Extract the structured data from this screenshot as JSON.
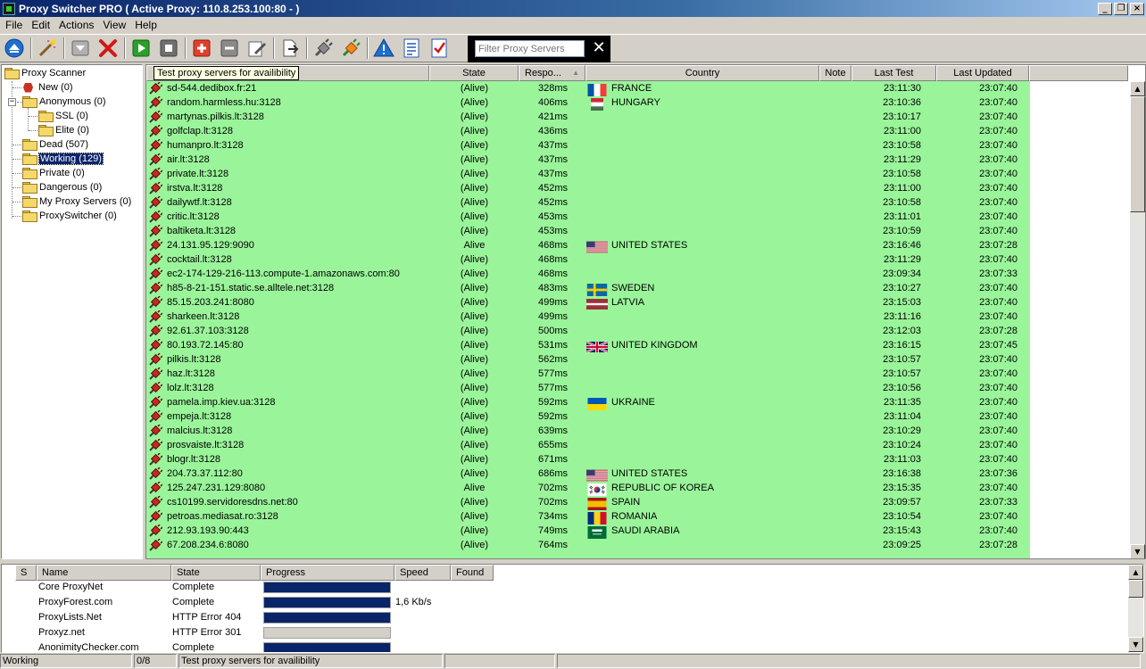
{
  "window": {
    "title": "Proxy Switcher PRO ( Active Proxy: 110.8.253.100:80 - )",
    "minimize": "_",
    "restore": "❐",
    "close": "×"
  },
  "menu": [
    "File",
    "Edit",
    "Actions",
    "View",
    "Help"
  ],
  "filter": {
    "placeholder": "Filter Proxy Servers",
    "clear": "✕"
  },
  "tree": {
    "items": [
      {
        "label": "Proxy Scanner"
      },
      {
        "label": "New (0)"
      },
      {
        "label": "Anonymous (0)"
      },
      {
        "label": "SSL (0)"
      },
      {
        "label": "Elite (0)"
      },
      {
        "label": "Dead (507)"
      },
      {
        "label": "Working (129)"
      },
      {
        "label": "Private (0)"
      },
      {
        "label": "Dangerous (0)"
      },
      {
        "label": "My Proxy Servers (0)"
      },
      {
        "label": "ProxySwitcher (0)"
      }
    ]
  },
  "grid": {
    "tooltip": "Test proxy servers for availibility",
    "columns": [
      "State",
      "Respo...",
      "Country",
      "Note",
      "Last Test",
      "Last Updated"
    ],
    "sort_indicator": "▲",
    "rows": [
      {
        "server": "sd-544.dedibox.fr:21",
        "state": "(Alive)",
        "resp": "328ms",
        "flag": "fr",
        "country": "FRANCE",
        "last_test": "23:11:30",
        "updated": "23:07:40"
      },
      {
        "server": "random.harmless.hu:3128",
        "state": "(Alive)",
        "resp": "406ms",
        "flag": "hu",
        "country": "HUNGARY",
        "last_test": "23:10:36",
        "updated": "23:07:40"
      },
      {
        "server": "martynas.pilkis.lt:3128",
        "state": "(Alive)",
        "resp": "421ms",
        "flag": "",
        "country": "",
        "last_test": "23:10:17",
        "updated": "23:07:40"
      },
      {
        "server": "golfclap.lt:3128",
        "state": "(Alive)",
        "resp": "436ms",
        "flag": "",
        "country": "",
        "last_test": "23:11:00",
        "updated": "23:07:40"
      },
      {
        "server": "humanpro.lt:3128",
        "state": "(Alive)",
        "resp": "437ms",
        "flag": "",
        "country": "",
        "last_test": "23:10:58",
        "updated": "23:07:40"
      },
      {
        "server": "air.lt:3128",
        "state": "(Alive)",
        "resp": "437ms",
        "flag": "",
        "country": "",
        "last_test": "23:11:29",
        "updated": "23:07:40"
      },
      {
        "server": "private.lt:3128",
        "state": "(Alive)",
        "resp": "437ms",
        "flag": "",
        "country": "",
        "last_test": "23:10:58",
        "updated": "23:07:40"
      },
      {
        "server": "irstva.lt:3128",
        "state": "(Alive)",
        "resp": "452ms",
        "flag": "",
        "country": "",
        "last_test": "23:11:00",
        "updated": "23:07:40"
      },
      {
        "server": "dailywtf.lt:3128",
        "state": "(Alive)",
        "resp": "452ms",
        "flag": "",
        "country": "",
        "last_test": "23:10:58",
        "updated": "23:07:40"
      },
      {
        "server": "critic.lt:3128",
        "state": "(Alive)",
        "resp": "453ms",
        "flag": "",
        "country": "",
        "last_test": "23:11:01",
        "updated": "23:07:40"
      },
      {
        "server": "baltiketa.lt:3128",
        "state": "(Alive)",
        "resp": "453ms",
        "flag": "",
        "country": "",
        "last_test": "23:10:59",
        "updated": "23:07:40"
      },
      {
        "server": "24.131.95.129:9090",
        "state": "Alive",
        "resp": "468ms",
        "flag": "us",
        "country": "UNITED STATES",
        "last_test": "23:16:46",
        "updated": "23:07:28"
      },
      {
        "server": "cocktail.lt:3128",
        "state": "(Alive)",
        "resp": "468ms",
        "flag": "",
        "country": "",
        "last_test": "23:11:29",
        "updated": "23:07:40"
      },
      {
        "server": "ec2-174-129-216-113.compute-1.amazonaws.com:80",
        "state": "(Alive)",
        "resp": "468ms",
        "flag": "",
        "country": "",
        "last_test": "23:09:34",
        "updated": "23:07:33"
      },
      {
        "server": "h85-8-21-151.static.se.alltele.net:3128",
        "state": "(Alive)",
        "resp": "483ms",
        "flag": "se",
        "country": "SWEDEN",
        "last_test": "23:10:27",
        "updated": "23:07:40"
      },
      {
        "server": "85.15.203.241:8080",
        "state": "(Alive)",
        "resp": "499ms",
        "flag": "lv",
        "country": "LATVIA",
        "last_test": "23:15:03",
        "updated": "23:07:40"
      },
      {
        "server": "sharkeen.lt:3128",
        "state": "(Alive)",
        "resp": "499ms",
        "flag": "",
        "country": "",
        "last_test": "23:11:16",
        "updated": "23:07:40"
      },
      {
        "server": "92.61.37.103:3128",
        "state": "(Alive)",
        "resp": "500ms",
        "flag": "",
        "country": "",
        "last_test": "23:12:03",
        "updated": "23:07:28"
      },
      {
        "server": "80.193.72.145:80",
        "state": "(Alive)",
        "resp": "531ms",
        "flag": "gb",
        "country": "UNITED KINGDOM",
        "last_test": "23:16:15",
        "updated": "23:07:45"
      },
      {
        "server": "pilkis.lt:3128",
        "state": "(Alive)",
        "resp": "562ms",
        "flag": "",
        "country": "",
        "last_test": "23:10:57",
        "updated": "23:07:40"
      },
      {
        "server": "haz.lt:3128",
        "state": "(Alive)",
        "resp": "577ms",
        "flag": "",
        "country": "",
        "last_test": "23:10:57",
        "updated": "23:07:40"
      },
      {
        "server": "lolz.lt:3128",
        "state": "(Alive)",
        "resp": "577ms",
        "flag": "",
        "country": "",
        "last_test": "23:10:56",
        "updated": "23:07:40"
      },
      {
        "server": "pamela.imp.kiev.ua:3128",
        "state": "(Alive)",
        "resp": "592ms",
        "flag": "ua",
        "country": "UKRAINE",
        "last_test": "23:11:35",
        "updated": "23:07:40"
      },
      {
        "server": "empeja.lt:3128",
        "state": "(Alive)",
        "resp": "592ms",
        "flag": "",
        "country": "",
        "last_test": "23:11:04",
        "updated": "23:07:40"
      },
      {
        "server": "malcius.lt:3128",
        "state": "(Alive)",
        "resp": "639ms",
        "flag": "",
        "country": "",
        "last_test": "23:10:29",
        "updated": "23:07:40"
      },
      {
        "server": "prosvaiste.lt:3128",
        "state": "(Alive)",
        "resp": "655ms",
        "flag": "",
        "country": "",
        "last_test": "23:10:24",
        "updated": "23:07:40"
      },
      {
        "server": "blogr.lt:3128",
        "state": "(Alive)",
        "resp": "671ms",
        "flag": "",
        "country": "",
        "last_test": "23:11:03",
        "updated": "23:07:40"
      },
      {
        "server": "204.73.37.112:80",
        "state": "(Alive)",
        "resp": "686ms",
        "flag": "us",
        "country": "UNITED STATES",
        "last_test": "23:16:38",
        "updated": "23:07:36"
      },
      {
        "server": "125.247.231.129:8080",
        "state": "Alive",
        "resp": "702ms",
        "flag": "kr",
        "country": "REPUBLIC OF KOREA",
        "last_test": "23:15:35",
        "updated": "23:07:40"
      },
      {
        "server": "cs10199.servidoresdns.net:80",
        "state": "(Alive)",
        "resp": "702ms",
        "flag": "es",
        "country": "SPAIN",
        "last_test": "23:09:57",
        "updated": "23:07:33"
      },
      {
        "server": "petroas.mediasat.ro:3128",
        "state": "(Alive)",
        "resp": "734ms",
        "flag": "ro",
        "country": "ROMANIA",
        "last_test": "23:10:54",
        "updated": "23:07:40"
      },
      {
        "server": "212.93.193.90:443",
        "state": "(Alive)",
        "resp": "749ms",
        "flag": "sa",
        "country": "SAUDI ARABIA",
        "last_test": "23:15:43",
        "updated": "23:07:40"
      },
      {
        "server": "67.208.234.6:8080",
        "state": "(Alive)",
        "resp": "764ms",
        "flag": "",
        "country": "",
        "last_test": "23:09:25",
        "updated": "23:07:28"
      }
    ]
  },
  "downloads": {
    "columns": [
      "S",
      "Name",
      "State",
      "Progress",
      "Speed",
      "Found"
    ],
    "rows": [
      {
        "name": "Core ProxyNet",
        "state": "Complete",
        "progress": 1.0,
        "speed": ""
      },
      {
        "name": "ProxyForest.com",
        "state": "Complete",
        "progress": 1.0,
        "speed": "1,6 Kb/s"
      },
      {
        "name": "ProxyLists.Net",
        "state": "HTTP Error 404",
        "progress": 1.0,
        "speed": ""
      },
      {
        "name": "Proxyz.net",
        "state": "HTTP Error 301",
        "progress": 0.0,
        "speed": ""
      },
      {
        "name": "AnonimityChecker.com",
        "state": "Complete",
        "progress": 1.0,
        "speed": ""
      }
    ]
  },
  "status": {
    "mode": "Working",
    "count": "0/8",
    "message": "Test proxy servers for availibility"
  },
  "colors": {
    "alive_row": "#9af59a",
    "progress_fill": "#0a246a",
    "selection": "#0a246a"
  }
}
